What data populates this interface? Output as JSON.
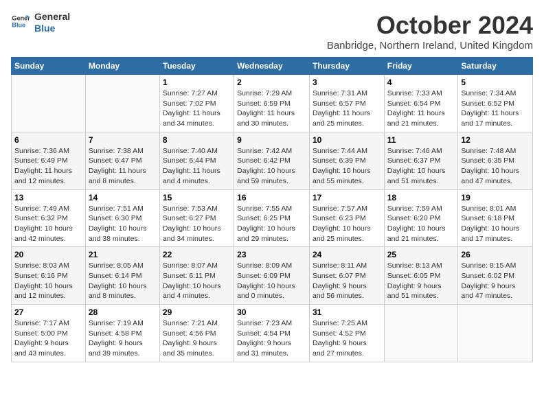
{
  "logo": {
    "line1": "General",
    "line2": "Blue"
  },
  "title": "October 2024",
  "location": "Banbridge, Northern Ireland, United Kingdom",
  "days_header": [
    "Sunday",
    "Monday",
    "Tuesday",
    "Wednesday",
    "Thursday",
    "Friday",
    "Saturday"
  ],
  "weeks": [
    [
      {
        "num": "",
        "detail": ""
      },
      {
        "num": "",
        "detail": ""
      },
      {
        "num": "1",
        "detail": "Sunrise: 7:27 AM\nSunset: 7:02 PM\nDaylight: 11 hours\nand 34 minutes."
      },
      {
        "num": "2",
        "detail": "Sunrise: 7:29 AM\nSunset: 6:59 PM\nDaylight: 11 hours\nand 30 minutes."
      },
      {
        "num": "3",
        "detail": "Sunrise: 7:31 AM\nSunset: 6:57 PM\nDaylight: 11 hours\nand 25 minutes."
      },
      {
        "num": "4",
        "detail": "Sunrise: 7:33 AM\nSunset: 6:54 PM\nDaylight: 11 hours\nand 21 minutes."
      },
      {
        "num": "5",
        "detail": "Sunrise: 7:34 AM\nSunset: 6:52 PM\nDaylight: 11 hours\nand 17 minutes."
      }
    ],
    [
      {
        "num": "6",
        "detail": "Sunrise: 7:36 AM\nSunset: 6:49 PM\nDaylight: 11 hours\nand 12 minutes."
      },
      {
        "num": "7",
        "detail": "Sunrise: 7:38 AM\nSunset: 6:47 PM\nDaylight: 11 hours\nand 8 minutes."
      },
      {
        "num": "8",
        "detail": "Sunrise: 7:40 AM\nSunset: 6:44 PM\nDaylight: 11 hours\nand 4 minutes."
      },
      {
        "num": "9",
        "detail": "Sunrise: 7:42 AM\nSunset: 6:42 PM\nDaylight: 10 hours\nand 59 minutes."
      },
      {
        "num": "10",
        "detail": "Sunrise: 7:44 AM\nSunset: 6:39 PM\nDaylight: 10 hours\nand 55 minutes."
      },
      {
        "num": "11",
        "detail": "Sunrise: 7:46 AM\nSunset: 6:37 PM\nDaylight: 10 hours\nand 51 minutes."
      },
      {
        "num": "12",
        "detail": "Sunrise: 7:48 AM\nSunset: 6:35 PM\nDaylight: 10 hours\nand 47 minutes."
      }
    ],
    [
      {
        "num": "13",
        "detail": "Sunrise: 7:49 AM\nSunset: 6:32 PM\nDaylight: 10 hours\nand 42 minutes."
      },
      {
        "num": "14",
        "detail": "Sunrise: 7:51 AM\nSunset: 6:30 PM\nDaylight: 10 hours\nand 38 minutes."
      },
      {
        "num": "15",
        "detail": "Sunrise: 7:53 AM\nSunset: 6:27 PM\nDaylight: 10 hours\nand 34 minutes."
      },
      {
        "num": "16",
        "detail": "Sunrise: 7:55 AM\nSunset: 6:25 PM\nDaylight: 10 hours\nand 29 minutes."
      },
      {
        "num": "17",
        "detail": "Sunrise: 7:57 AM\nSunset: 6:23 PM\nDaylight: 10 hours\nand 25 minutes."
      },
      {
        "num": "18",
        "detail": "Sunrise: 7:59 AM\nSunset: 6:20 PM\nDaylight: 10 hours\nand 21 minutes."
      },
      {
        "num": "19",
        "detail": "Sunrise: 8:01 AM\nSunset: 6:18 PM\nDaylight: 10 hours\nand 17 minutes."
      }
    ],
    [
      {
        "num": "20",
        "detail": "Sunrise: 8:03 AM\nSunset: 6:16 PM\nDaylight: 10 hours\nand 12 minutes."
      },
      {
        "num": "21",
        "detail": "Sunrise: 8:05 AM\nSunset: 6:14 PM\nDaylight: 10 hours\nand 8 minutes."
      },
      {
        "num": "22",
        "detail": "Sunrise: 8:07 AM\nSunset: 6:11 PM\nDaylight: 10 hours\nand 4 minutes."
      },
      {
        "num": "23",
        "detail": "Sunrise: 8:09 AM\nSunset: 6:09 PM\nDaylight: 10 hours\nand 0 minutes."
      },
      {
        "num": "24",
        "detail": "Sunrise: 8:11 AM\nSunset: 6:07 PM\nDaylight: 9 hours\nand 56 minutes."
      },
      {
        "num": "25",
        "detail": "Sunrise: 8:13 AM\nSunset: 6:05 PM\nDaylight: 9 hours\nand 51 minutes."
      },
      {
        "num": "26",
        "detail": "Sunrise: 8:15 AM\nSunset: 6:02 PM\nDaylight: 9 hours\nand 47 minutes."
      }
    ],
    [
      {
        "num": "27",
        "detail": "Sunrise: 7:17 AM\nSunset: 5:00 PM\nDaylight: 9 hours\nand 43 minutes."
      },
      {
        "num": "28",
        "detail": "Sunrise: 7:19 AM\nSunset: 4:58 PM\nDaylight: 9 hours\nand 39 minutes."
      },
      {
        "num": "29",
        "detail": "Sunrise: 7:21 AM\nSunset: 4:56 PM\nDaylight: 9 hours\nand 35 minutes."
      },
      {
        "num": "30",
        "detail": "Sunrise: 7:23 AM\nSunset: 4:54 PM\nDaylight: 9 hours\nand 31 minutes."
      },
      {
        "num": "31",
        "detail": "Sunrise: 7:25 AM\nSunset: 4:52 PM\nDaylight: 9 hours\nand 27 minutes."
      },
      {
        "num": "",
        "detail": ""
      },
      {
        "num": "",
        "detail": ""
      }
    ]
  ]
}
